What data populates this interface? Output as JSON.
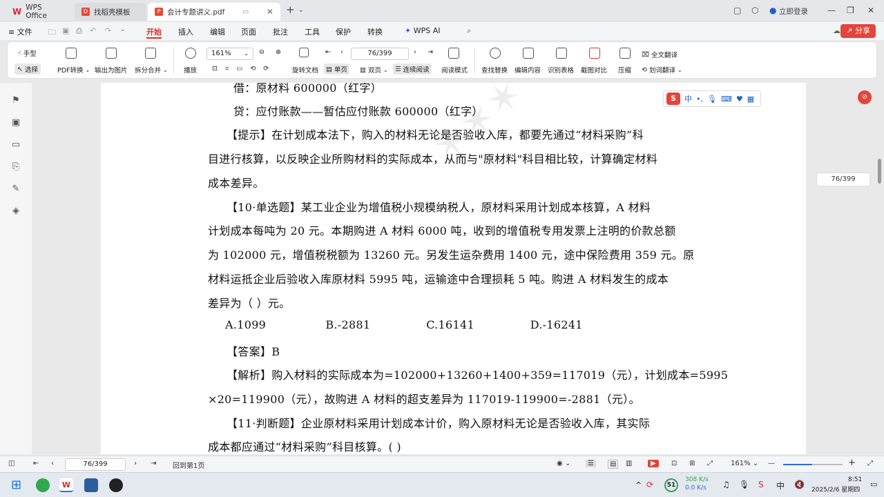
{
  "tabs": [
    {
      "label": "WPS Office"
    },
    {
      "label": "找稻壳模板"
    },
    {
      "label": "会计专题讲义.pdf"
    }
  ],
  "window": {
    "login_label": "立即登录"
  },
  "menu": {
    "items": [
      "文件",
      "开始",
      "插入",
      "编辑",
      "页面",
      "批注",
      "工具",
      "保护",
      "转换",
      "WPS AI"
    ],
    "share": "分享"
  },
  "toolbar": {
    "hand": "手型",
    "select": "选择",
    "pdf_convert": "PDF转换",
    "export_image": "输出为图片",
    "split_merge": "拆分合并",
    "play": "播放",
    "zoom": "161%",
    "page_field": "76/399",
    "rotate": "旋转文档",
    "single": "单页",
    "double": "双页",
    "continuous": "连续阅读",
    "read_mode": "阅读模式",
    "find_replace": "查找替换",
    "edit_content": "编辑内容",
    "recognize_table": "识别表格",
    "screenshot_compare": "截图对比",
    "compress": "压缩",
    "full_translate": "全文翻译",
    "word_translate": "划词翻译"
  },
  "document": {
    "lines": [
      "借：原材料                                          600000（红字）",
      "  贷：应付账款——暂估应付账款                       600000（红字）",
      "【提示】在计划成本法下，购入的材料无论是否验收入库，都要先通过“材料采购”科",
      "目进行核算，以反映企业所购材料的实际成本，从而与\"原材料\"科目相比较，计算确定材料",
      "成本差异。",
      "【10·单选题】某工业企业为增值税小规模纳税人，原材料采用计划成本核算，A 材料",
      "计划成本每吨为 20 元。本期购进 A 材料 6000 吨，收到的增值税专用发票上注明的价款总额",
      "为 102000 元，增值税税额为 13260 元。另发生运杂费用 1400 元，途中保险费用 359 元。原",
      "材料运抵企业后验收入库原材料 5995 吨，运输途中合理损耗 5 吨。购进 A 材料发生的成本",
      "差异为（     ）元。",
      "A.1099                B.-2881               C.16141               D.-16241",
      "【答案】B",
      "【解析】购入材料的实际成本为=102000+13260+1400+359=117019（元），计划成本=5995",
      "×20=119900（元），故购进 A 材料的超支差异为 117019-119900=-2881（元）。",
      "【11·判断题】企业原材料采用计划成本计价，购入原材料无论是否验收入库，其实际",
      "成本都应通过“材料采购”科目核算。(      )"
    ]
  },
  "float": {
    "page_indicator": "76/399",
    "ime_lang": "中"
  },
  "status": {
    "page_field": "76/399",
    "back_first": "回到第1页",
    "zoom": "161%"
  },
  "taskbar": {
    "badge": "51",
    "net_up": "308 K/s",
    "net_down": "0.0 K/s",
    "time": "8:51",
    "date": "2025/2/6 星期四"
  }
}
